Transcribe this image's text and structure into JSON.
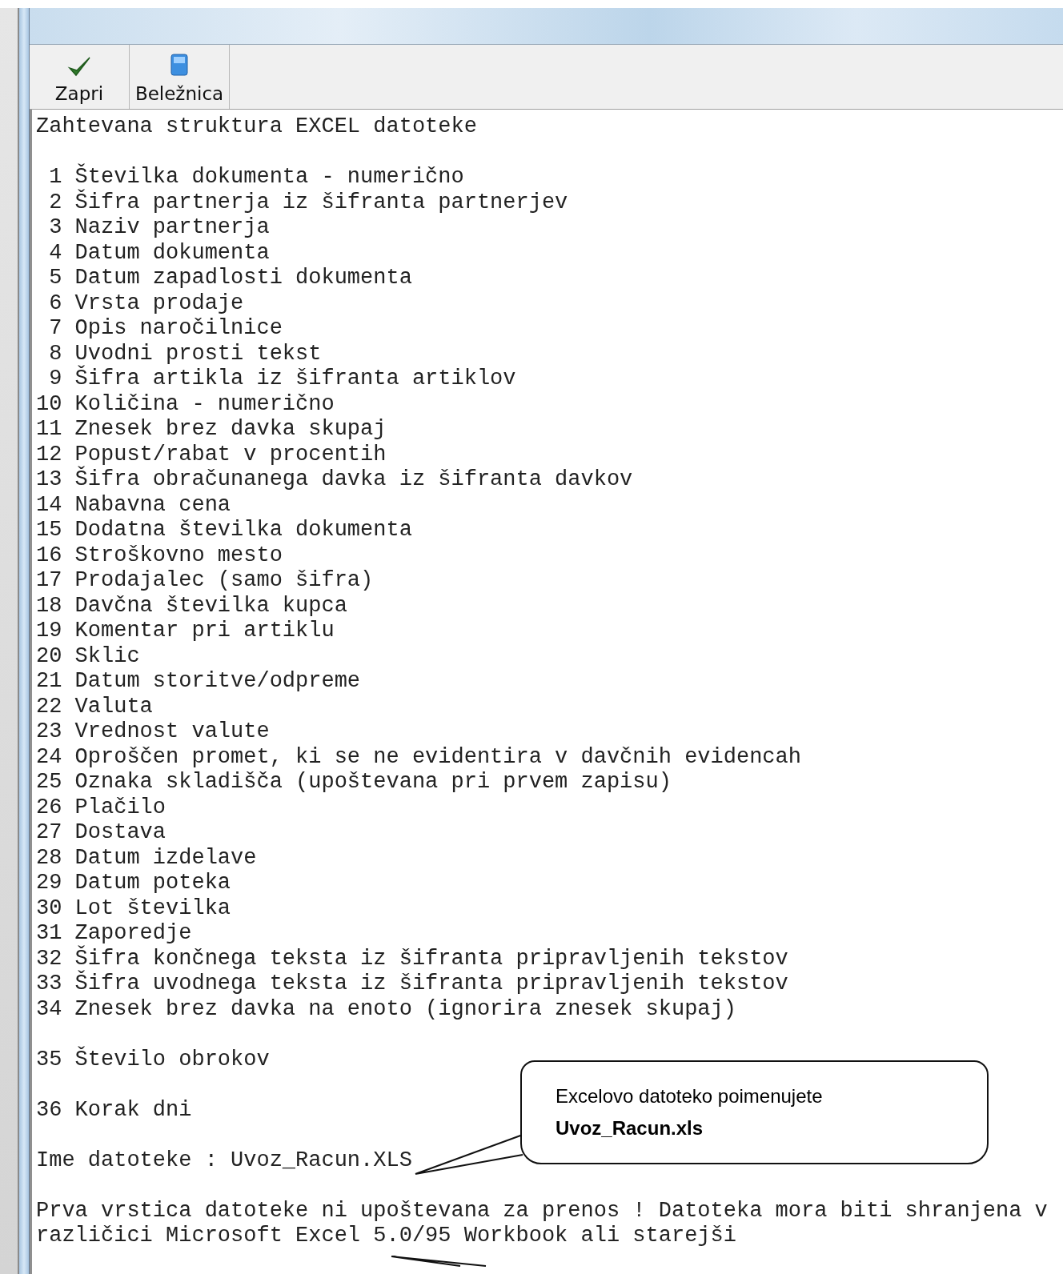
{
  "toolbar": {
    "buttons": [
      {
        "kind": "check",
        "label": "Zapri"
      },
      {
        "kind": "notebook",
        "label": "Beležnica"
      }
    ]
  },
  "document": {
    "paragraphs": [
      [
        "Zahtevana struktura EXCEL datoteke"
      ],
      [
        " 1 Številka dokumenta - numerično",
        " 2 Šifra partnerja iz šifranta partnerjev",
        " 3 Naziv partnerja",
        " 4 Datum dokumenta",
        " 5 Datum zapadlosti dokumenta",
        " 6 Vrsta prodaje",
        " 7 Opis naročilnice",
        " 8 Uvodni prosti tekst",
        " 9 Šifra artikla iz šifranta artiklov",
        "10 Količina - numerično",
        "11 Znesek brez davka skupaj",
        "12 Popust/rabat v procentih",
        "13 Šifra obračunanega davka iz šifranta davkov",
        "14 Nabavna cena",
        "15 Dodatna številka dokumenta",
        "16 Stroškovno mesto",
        "17 Prodajalec (samo šifra)",
        "18 Davčna številka kupca",
        "19 Komentar pri artiklu",
        "20 Sklic",
        "21 Datum storitve/odpreme",
        "22 Valuta",
        "23 Vrednost valute",
        "24 Oproščen promet, ki se ne evidentira v davčnih evidencah",
        "25 Oznaka skladišča (upoštevana pri prvem zapisu)",
        "26 Plačilo",
        "27 Dostava",
        "28 Datum izdelave",
        "29 Datum poteka",
        "30 Lot številka",
        "31 Zaporedje",
        "32 Šifra končnega teksta iz šifranta pripravljenih tekstov",
        "33 Šifra uvodnega teksta iz šifranta pripravljenih tekstov",
        "34 Znesek brez davka na enoto (ignorira znesek skupaj)"
      ],
      [
        "35 Število obrokov"
      ],
      [
        "36 Korak dni"
      ],
      [
        "Ime datoteke : Uvoz_Racun.XLS"
      ],
      [
        "Prva vrstica datoteke ni upoštevana za prenos ! Datoteka mora biti shranjena v",
        "različici Microsoft Excel 5.0/95 Workbook ali starejši"
      ]
    ]
  },
  "callout": {
    "text": "Excelovo datoteko poimenujete",
    "filename": "Uvoz_Racun.xls"
  }
}
